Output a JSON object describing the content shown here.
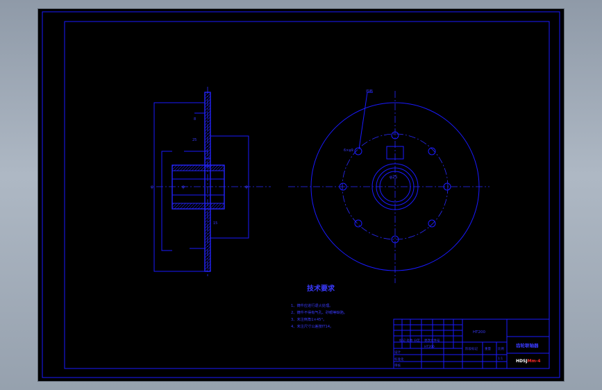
{
  "drawing": {
    "tech_req_title": "技术要求",
    "tech_req_items": [
      "1、铸件应进行退火处理。",
      "2、铸件不得有气孔、砂眼等缺陷。",
      "3、未注倒角1×45°。",
      "4、未注尺寸公差按IT14。"
    ],
    "side_view_marks": {
      "left_dim": "φ",
      "mid_dim": "φ",
      "right_dim": "φ",
      "upper_a": "8",
      "upper_b": "25",
      "lower": "15"
    },
    "front_view_marks": {
      "keyway": "φ25",
      "pitch": "6×φ9",
      "leader_top": "均布"
    },
    "title_block": {
      "part_name": "齿轮联轴器",
      "drawing_no_white": "HDSJ",
      "drawing_no_red": "Mm-4",
      "material": "HT200",
      "mark1": "标记 处数 分区",
      "mark2": "更改文件号",
      "mark3": "签名",
      "mark4": "年月日",
      "scale_label": "阶段标记",
      "weight": "重量",
      "ratio": "比例",
      "sheet": "1:1",
      "designer": "设计",
      "approver": "标准化",
      "checker": "审核",
      "process": "工艺"
    }
  },
  "colors": {
    "line": "#1a1aff",
    "background": "#000000",
    "frame_bg": "#9aa5b2",
    "title_white": "#ffffff",
    "title_red": "#ff2a2a"
  }
}
